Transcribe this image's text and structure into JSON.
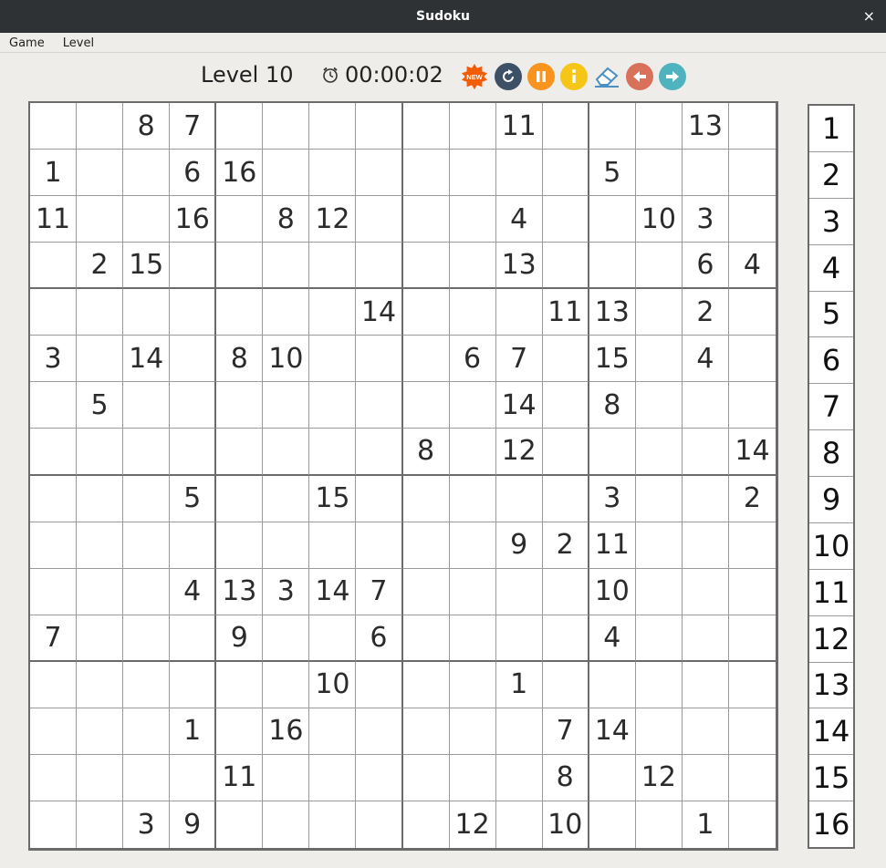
{
  "window": {
    "title": "Sudoku",
    "close_glyph": "×"
  },
  "menu": {
    "items": [
      "Game",
      "Level"
    ]
  },
  "toolbar": {
    "level_label": "Level 10",
    "timer": "00:00:02",
    "clock_icon": "alarm-clock-icon",
    "buttons": [
      {
        "name": "new-game-button",
        "icon": "new-starburst-icon",
        "text": "NEW",
        "color": "#f25c05"
      },
      {
        "name": "restart-button",
        "icon": "restart-icon",
        "color": "#3d5166"
      },
      {
        "name": "pause-button",
        "icon": "pause-icon",
        "color": "#f7931e"
      },
      {
        "name": "info-button",
        "icon": "info-icon",
        "color": "#f5c518"
      },
      {
        "name": "eraser-button",
        "icon": "eraser-icon",
        "color": "#4a90c2"
      },
      {
        "name": "undo-button",
        "icon": "arrow-left-icon",
        "color": "#d9705a"
      },
      {
        "name": "redo-button",
        "icon": "arrow-right-icon",
        "color": "#4fb3bf"
      }
    ]
  },
  "board": {
    "size": 16,
    "box_size": 4,
    "rows": [
      [
        "",
        "",
        "8",
        "7",
        "",
        "",
        "",
        "",
        "",
        "",
        "11",
        "",
        "",
        "",
        "13",
        ""
      ],
      [
        "1",
        "",
        "",
        "6",
        "16",
        "",
        "",
        "",
        "",
        "",
        "",
        "",
        "5",
        "",
        "",
        ""
      ],
      [
        "11",
        "",
        "",
        "16",
        "",
        "8",
        "12",
        "",
        "",
        "",
        "4",
        "",
        "",
        "10",
        "3",
        ""
      ],
      [
        "",
        "2",
        "15",
        "",
        "",
        "",
        "",
        "",
        "",
        "",
        "13",
        "",
        "",
        "",
        "6",
        "4"
      ],
      [
        "",
        "",
        "",
        "",
        "",
        "",
        "",
        "14",
        "",
        "",
        "",
        "11",
        "13",
        "",
        "2",
        ""
      ],
      [
        "3",
        "",
        "14",
        "",
        "8",
        "10",
        "",
        "",
        "",
        "6",
        "7",
        "",
        "15",
        "",
        "4",
        ""
      ],
      [
        "",
        "5",
        "",
        "",
        "",
        "",
        "",
        "",
        "",
        "",
        "14",
        "",
        "8",
        "",
        "",
        ""
      ],
      [
        "",
        "",
        "",
        "",
        "",
        "",
        "",
        "",
        "8",
        "",
        "12",
        "",
        "",
        "",
        "",
        "14"
      ],
      [
        "",
        "",
        "",
        "5",
        "",
        "",
        "15",
        "",
        "",
        "",
        "",
        "",
        "3",
        "",
        "",
        "2"
      ],
      [
        "",
        "",
        "",
        "",
        "",
        "",
        "",
        "",
        "",
        "",
        "9",
        "2",
        "11",
        "",
        "",
        ""
      ],
      [
        "",
        "",
        "",
        "4",
        "13",
        "3",
        "14",
        "7",
        "",
        "",
        "",
        "",
        "10",
        "",
        "",
        ""
      ],
      [
        "7",
        "",
        "",
        "",
        "9",
        "",
        "",
        "6",
        "",
        "",
        "",
        "",
        "4",
        "",
        "",
        ""
      ],
      [
        "",
        "",
        "",
        "",
        "",
        "",
        "10",
        "",
        "",
        "",
        "1",
        "",
        "",
        "",
        "",
        ""
      ],
      [
        "",
        "",
        "",
        "1",
        "",
        "16",
        "",
        "",
        "",
        "",
        "",
        "7",
        "14",
        "",
        "",
        ""
      ],
      [
        "",
        "",
        "",
        "",
        "11",
        "",
        "",
        "",
        "",
        "",
        "",
        "8",
        "",
        "12",
        "",
        ""
      ],
      [
        "",
        "",
        "3",
        "9",
        "",
        "",
        "",
        "",
        "",
        "12",
        "",
        "10",
        "",
        "",
        "1",
        ""
      ]
    ]
  },
  "palette": {
    "numbers": [
      "1",
      "2",
      "3",
      "4",
      "5",
      "6",
      "7",
      "8",
      "9",
      "10",
      "11",
      "12",
      "13",
      "14",
      "15",
      "16"
    ]
  }
}
